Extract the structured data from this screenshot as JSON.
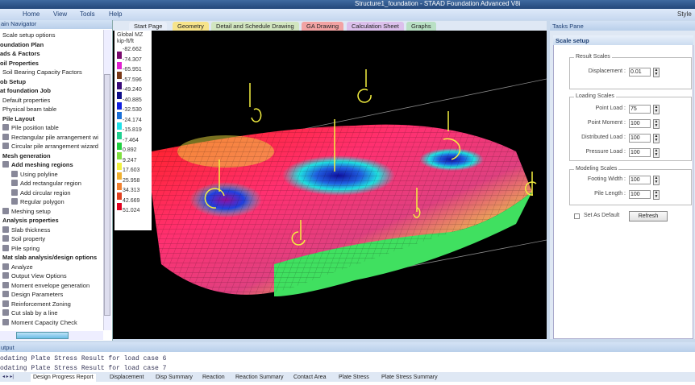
{
  "window": {
    "title": "Structure1_foundation - STAAD Foundation Advanced V8i"
  },
  "menu": [
    "Home",
    "View",
    "Tools",
    "Help"
  ],
  "menu_right": {
    "style": "Style"
  },
  "navigator": {
    "title": "ain Navigator",
    "items": [
      {
        "label": "Scale setup options",
        "bold": false,
        "indent": 1
      },
      {
        "label": "oundation Plan",
        "bold": true,
        "indent": 0
      },
      {
        "label": "ads & Factors",
        "bold": true,
        "indent": 0
      },
      {
        "label": "oil Properties",
        "bold": true,
        "indent": 0
      },
      {
        "label": "Soil Bearing Capacity Factors",
        "bold": false,
        "indent": 1
      },
      {
        "label": "ob Setup",
        "bold": true,
        "indent": 0
      },
      {
        "label": "at foundation Job",
        "bold": true,
        "indent": 0
      },
      {
        "label": "Default properties",
        "bold": false,
        "indent": 1
      },
      {
        "label": "Physical beam table",
        "bold": false,
        "indent": 1
      },
      {
        "label": "Pile Layout",
        "bold": true,
        "indent": 1
      },
      {
        "label": "Pile position table",
        "bold": false,
        "indent": 2
      },
      {
        "label": "Rectangular pile arrangement wi",
        "bold": false,
        "indent": 2
      },
      {
        "label": "Circular pile arrangement wizard",
        "bold": false,
        "indent": 2
      },
      {
        "label": "Mesh generation",
        "bold": true,
        "indent": 1
      },
      {
        "label": "Add meshing regions",
        "bold": true,
        "indent": 2
      },
      {
        "label": "Using polyline",
        "bold": false,
        "indent": 3
      },
      {
        "label": "Add rectangular region",
        "bold": false,
        "indent": 3
      },
      {
        "label": "Add circular region",
        "bold": false,
        "indent": 3
      },
      {
        "label": "Regular polygon",
        "bold": false,
        "indent": 3
      },
      {
        "label": "Meshing setup",
        "bold": false,
        "indent": 2
      },
      {
        "label": "Analysis properties",
        "bold": true,
        "indent": 1
      },
      {
        "label": "Slab thickness",
        "bold": false,
        "indent": 2
      },
      {
        "label": "Soil property",
        "bold": false,
        "indent": 2
      },
      {
        "label": "Pile spring",
        "bold": false,
        "indent": 2
      },
      {
        "label": "Mat slab analysis/design options",
        "bold": true,
        "indent": 1
      },
      {
        "label": "Analyze",
        "bold": false,
        "indent": 2
      },
      {
        "label": "Output View Options",
        "bold": false,
        "indent": 2
      },
      {
        "label": "Moment envelope generation",
        "bold": false,
        "indent": 2
      },
      {
        "label": "Design Parameters",
        "bold": false,
        "indent": 2
      },
      {
        "label": "Reinforcement Zoning",
        "bold": false,
        "indent": 2
      },
      {
        "label": "Cut slab by a line",
        "bold": false,
        "indent": 2
      },
      {
        "label": "Moment Capacity Check",
        "bold": false,
        "indent": 2
      }
    ]
  },
  "doc_tabs": [
    {
      "label": "Start Page",
      "color": "#e8eef8"
    },
    {
      "label": "Geometry",
      "color": "#f7e48a"
    },
    {
      "label": "Detail and Schedule Drawing",
      "color": "#d2e6c0"
    },
    {
      "label": "GA Drawing",
      "color": "#f2a3a3"
    },
    {
      "label": "Calculation Sheet",
      "color": "#dcc0ec"
    },
    {
      "label": "Graphs",
      "color": "#b9e0c4"
    }
  ],
  "legend": {
    "title": "Global MZ",
    "unit": "kip-ft/ft",
    "values": [
      "-82.662",
      "-74.307",
      "-65.951",
      "-57.596",
      "-49.240",
      "-40.885",
      "-32.530",
      "-24.174",
      "-15.819",
      "-7.464",
      "0.892",
      "9.247",
      "17.603",
      "25.958",
      "34.313",
      "42.669",
      "51.024"
    ],
    "colors": [
      "#7a0a6e",
      "#e020d0",
      "#7a3a18",
      "#3a0a78",
      "#10108a",
      "#1020e0",
      "#1a70d8",
      "#20e0e8",
      "#20d090",
      "#20d040",
      "#80e040",
      "#f0f040",
      "#f0b030",
      "#f08030",
      "#e04020",
      "#e00020"
    ]
  },
  "tasks_pane": {
    "title": "Tasks Pane",
    "section": "Scale setup",
    "result_scales": {
      "title": "Result Scales",
      "fields": [
        {
          "label": "Displacement :",
          "value": "0.01"
        }
      ]
    },
    "loading_scales": {
      "title": "Loading Scales",
      "fields": [
        {
          "label": "Point Load :",
          "value": "75"
        },
        {
          "label": "Point Moment :",
          "value": "100"
        },
        {
          "label": "Distributed Load :",
          "value": "100"
        },
        {
          "label": "Pressure Load :",
          "value": "100"
        }
      ]
    },
    "modeling_scales": {
      "title": "Modeling Scales",
      "fields": [
        {
          "label": "Footing Width :",
          "value": "100"
        },
        {
          "label": "Pile Length :",
          "value": "100"
        }
      ]
    },
    "set_default": "Set As Default",
    "refresh": "Refresh"
  },
  "output": {
    "title": "utput",
    "lines": [
      "odating Plate Stress Result for load case 6",
      "odating Plate Stress Result for load case 7"
    ],
    "tabs": [
      "Design Progress Report",
      "Displacement",
      "Disp Summary",
      "Reaction",
      "Reaction Summary",
      "Contact Area",
      "Plate Stress",
      "Plate Stress Summary"
    ]
  }
}
